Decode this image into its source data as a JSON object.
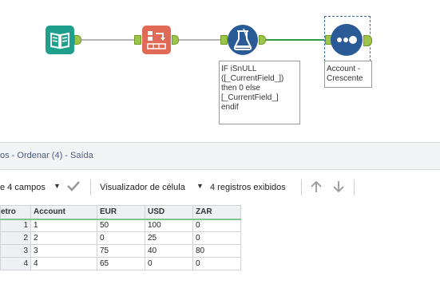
{
  "canvas": {
    "tools": [
      {
        "name": "input-data",
        "icon": "book-icon",
        "color": "#1ea08c"
      },
      {
        "name": "sort",
        "icon": "sort-icon",
        "color": "#e06a57"
      },
      {
        "name": "formula",
        "icon": "formula-flask-icon",
        "color": "#2a5b96"
      },
      {
        "name": "browse",
        "icon": "browse-dots-icon",
        "color": "#2a5b96"
      }
    ],
    "formula_annotation": "IF iSnULL\n([_CurrentField_])\nthen 0 else\n[_CurrentField_]\nendif",
    "browse_annotation": "Account -\nCrescente"
  },
  "results": {
    "title_prefix": "os",
    "title_rest": " - Ordenar (4) - Saída",
    "fields_label": "e 4 campos",
    "cell_viewer_label": "Visualizador de célula",
    "records_label": "4 registros exibidos"
  },
  "grid": {
    "columns": [
      "etro",
      "Account",
      "EUR",
      "USD",
      "ZAR"
    ],
    "rows": [
      [
        "1",
        "1",
        "50",
        "100",
        "0"
      ],
      [
        "2",
        "2",
        "0",
        "25",
        "0"
      ],
      [
        "3",
        "3",
        "75",
        "40",
        "80"
      ],
      [
        "4",
        "4",
        "65",
        "0",
        "0"
      ]
    ]
  },
  "colors": {
    "connection_gray": "#b6b6b6",
    "connection_green": "#2f9a4a",
    "anchor": "#9dc44a",
    "header_underline": "#7cc58b"
  }
}
